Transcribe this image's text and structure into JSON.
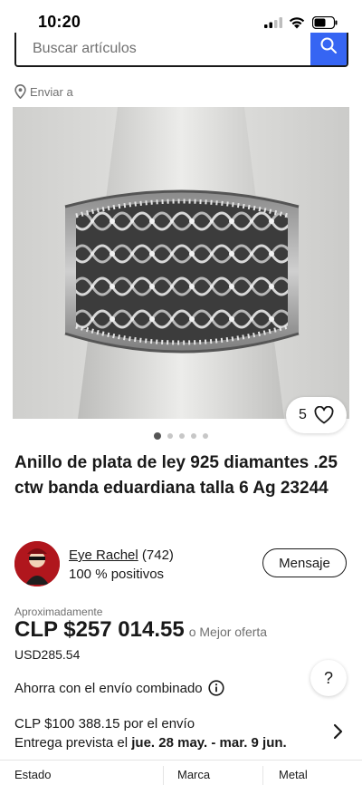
{
  "status_bar": {
    "time": "10:20"
  },
  "search": {
    "placeholder": "Buscar artículos"
  },
  "ship_to": {
    "label": "Enviar a"
  },
  "gallery": {
    "counter": "5",
    "dot_count": 5,
    "active_dot": 0
  },
  "listing": {
    "title": "Anillo de plata de ley 925 diamantes .25 ctw banda eduardiana talla 6 Ag 23244"
  },
  "seller": {
    "name": "Eye Rachel",
    "feedback_count": "(742)",
    "positive": "100 % positivos",
    "contact_label": "Mensaje"
  },
  "price": {
    "approx_label": "Aproximadamente",
    "amount": "CLP $257 014.55",
    "best_offer": "o Mejor oferta",
    "usd": "USD285.54"
  },
  "combined_shipping": {
    "label": "Ahorra con el envío combinado"
  },
  "help": {
    "label": "?"
  },
  "shipping": {
    "cost": "CLP $100 388.15 por el envío",
    "delivery_prefix": "Entrega prevista el",
    "delivery_dates": "jue. 28 may. - mar. 9 jun."
  },
  "specifics": {
    "headers": [
      "Estado",
      "Marca",
      "Metal"
    ]
  },
  "colors": {
    "accent": "#3665f3",
    "text": "#191919",
    "muted": "#707070"
  }
}
